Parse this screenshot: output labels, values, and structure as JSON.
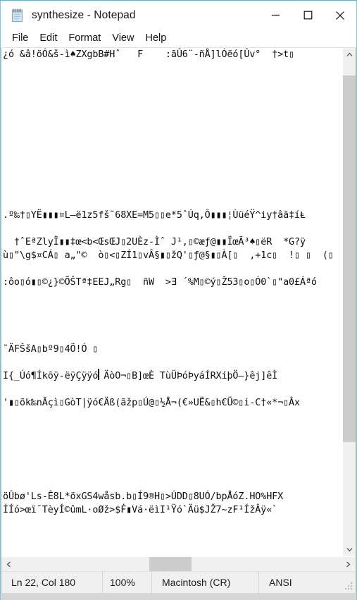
{
  "window": {
    "title": "synthesize - Notepad",
    "app_icon": "notepad-icon",
    "controls": {
      "minimize": "minimize-icon",
      "maximize": "maximize-icon",
      "close": "close-icon"
    }
  },
  "menubar": {
    "items": [
      {
        "label": "File"
      },
      {
        "label": "Edit"
      },
      {
        "label": "Format"
      },
      {
        "label": "View"
      },
      {
        "label": "Help"
      }
    ]
  },
  "editor": {
    "lines": [
      "¿ó &â!öÓ&š-ì♠ZXgbB#Hˆ   F    :ãÛ6¨-ñÅ]lÓëó[Ûv°  †>t▯",
      "",
      "",
      "",
      "",
      "",
      "",
      "",
      "",
      "",
      "",
      "",
      ".º‰†▯YË▮▮▮¤L–ë1z5fš˜68XE=M5▯▯e*5ˆÚq,Ô▮▮▮¦ÙüéŸ^iy†âã‡íⱠ",
      "",
      "  †ˆEªZlyÏ▮▮‡œ<b<ŒsŒJ▯2UÈz-Ìˆ J¹,▯©æƒ@▮▮ÏœÃ³♠▯ëR  *G?ÿ",
      "ù▯\"\\g$¤CÁ▯ a„\"©  ò▯<▯ZÍ1▯vÂ§▮▯žQ'▯ƒ@§▮▯À[▯  ,+1c▯  !▯ ▯  (▯",
      "",
      ":ôo▯ó▮▯©¿}©ÕŠTª‡EEJ„Rg▯  ñW  >Ǝ ´%M▯©ý▯Ž53▯o▯Ó0`▯\"a0£Áªó",
      "",
      "",
      "",
      "",
      "˜ÄFŠšA▯bº9▯4Ö!Ó ▯",
      "",
      "I{_Úó¶Íkõÿ-ëÿÇÿÿó ÄòO¬▯B]œÈ TùÜÞóÞyáÍRXíþÖ—}êj]êÌ",
      "",
      "'▮▯õk‰nÃçì▯GòT|ÿó€Äß(ãžp▯Ú@▯½Å¬(€»UË&▯h€Ü©▯i-C†«*¬▯Âx",
      "",
      "",
      "",
      "",
      "",
      "",
      "öÛbø'Ls-Ê8L*öxGS4wåsb.b▯Í9®H▯>ÚDD▯8UÓ/bpÅóZ.HO%HFX",
      "ÍÍó>œï¯TèyÍ©ûmL·oØž>$Ḟ▮Vá·ëìI¹Ÿó`Äü$JŽ7~zF¹ÍžÂÿ«`"
    ],
    "caret": "text-cursor"
  },
  "scrollbars": {
    "vertical": {
      "up_arrow": "chevron-up-icon",
      "down_arrow": "chevron-down-icon",
      "thumb": "vertical-scroll-thumb"
    },
    "horizontal": {
      "left_arrow": "chevron-left-icon",
      "right_arrow": "chevron-right-icon",
      "thumb": "horizontal-scroll-thumb"
    }
  },
  "statusbar": {
    "position": "Ln 22, Col 180",
    "zoom": "100%",
    "line_ending": "Macintosh (CR)",
    "encoding": "ANSI",
    "resize_grip": "resize-grip-icon"
  },
  "colors": {
    "window_border": "#9bbfc9",
    "chrome": "#f0f0f0",
    "scroll_thumb": "#cdcdcd",
    "text": "#0d0d0d"
  }
}
